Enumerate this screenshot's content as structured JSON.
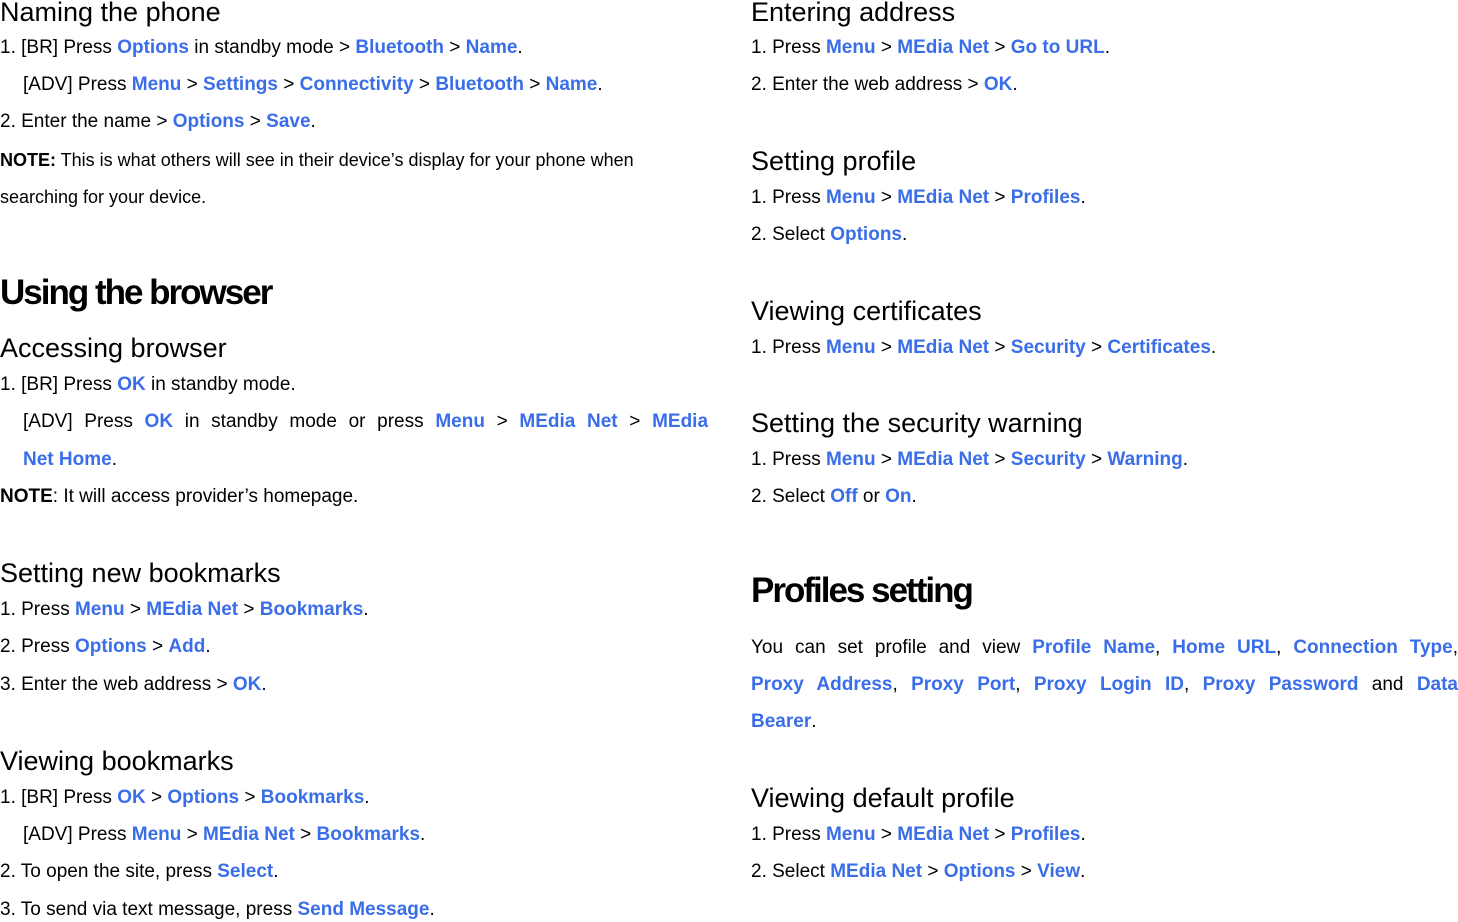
{
  "left": {
    "naming": {
      "title": "Naming the phone",
      "l1": {
        "a": "1. [BR] Press ",
        "k1": "Options",
        "b": " in standby mode > ",
        "k2": "Bluetooth",
        "c": " > ",
        "k3": "Name",
        "d": "."
      },
      "l2": {
        "a": "[ADV] Press ",
        "k1": "Menu",
        "b": " > ",
        "k2": "Settings",
        "c": " > ",
        "k3": "Connectivity",
        "d": " > ",
        "k4": "Bluetooth",
        "e": " > ",
        "k5": "Name",
        "f": "."
      },
      "l3": {
        "a": "2. Enter the name > ",
        "k1": "Options",
        "b": " > ",
        "k2": "Save",
        "c": "."
      },
      "note": {
        "label": "NOTE:",
        "text1": " This is what others will see in their device’s display for your phone when",
        "text2": "searching for your device."
      }
    },
    "browser": {
      "heading": "Using the browser",
      "accessing": {
        "title": "Accessing browser",
        "l1": {
          "a": "1. [BR] Press ",
          "k1": "OK",
          "b": " in standby mode."
        },
        "l2": {
          "a": "[ADV] Press ",
          "k1": "OK",
          "b": " in standby mode or press ",
          "k2": "Menu",
          "c": " > ",
          "k3": "MEdia Net",
          "d": " > ",
          "k4": "MEdia"
        },
        "l3": {
          "k1": "Net Home",
          "a": "."
        },
        "note": {
          "label": "NOTE",
          "text": ": It will access provider’s homepage."
        }
      },
      "new_bookmarks": {
        "title": "Setting new bookmarks",
        "l1": {
          "a": "1. Press ",
          "k1": "Menu",
          "b": " > ",
          "k2": "MEdia Net",
          "c": " > ",
          "k3": "Bookmarks",
          "d": "."
        },
        "l2": {
          "a": "2. Press ",
          "k1": "Options",
          "b": " > ",
          "k2": "Add",
          "c": "."
        },
        "l3": {
          "a": "3. Enter the web address > ",
          "k1": "OK",
          "b": "."
        }
      },
      "viewing_bookmarks": {
        "title": "Viewing bookmarks",
        "l1": {
          "a": "1. [BR] Press ",
          "k1": "OK",
          "b": " > ",
          "k2": "Options",
          "c": " > ",
          "k3": "Bookmarks",
          "d": "."
        },
        "l2": {
          "a": "[ADV] Press ",
          "k1": "Menu",
          "b": " > ",
          "k2": "MEdia Net",
          "c": " > ",
          "k3": "Bookmarks",
          "d": "."
        },
        "l3": {
          "a": "2. To open the site, press ",
          "k1": "Select",
          "b": "."
        },
        "l4": {
          "a": "3. To send via text message, press ",
          "k1": "Send Message",
          "b": "."
        }
      }
    }
  },
  "right": {
    "entering_address": {
      "title": "Entering address",
      "l1": {
        "a": "1. Press ",
        "k1": "Menu",
        "b": " > ",
        "k2": "MEdia Net",
        "c": " > ",
        "k3": "Go to URL",
        "d": "."
      },
      "l2": {
        "a": "2. Enter the web address > ",
        "k1": "OK",
        "b": "."
      }
    },
    "setting_profile": {
      "title": "Setting profile",
      "l1": {
        "a": "1. Press ",
        "k1": "Menu",
        "b": " > ",
        "k2": "MEdia Net",
        "c": " > ",
        "k3": "Profiles",
        "d": "."
      },
      "l2": {
        "a": "2. Select ",
        "k1": "Options",
        "b": "."
      }
    },
    "certificates": {
      "title": "Viewing certificates",
      "l1": {
        "a": "1. Press ",
        "k1": "Menu",
        "b": " > ",
        "k2": "MEdia Net",
        "c": " > ",
        "k3": "Security",
        "d": " > ",
        "k4": "Certificates",
        "e": "."
      }
    },
    "security_warning": {
      "title": "Setting the security warning",
      "l1": {
        "a": "1. Press ",
        "k1": "Menu",
        "b": " > ",
        "k2": "MEdia Net",
        "c": " > ",
        "k3": "Security",
        "d": " > ",
        "k4": "Warning",
        "e": "."
      },
      "l2": {
        "a": "2. Select ",
        "k1": "Off",
        "b": " or ",
        "k2": "On",
        "c": "."
      }
    },
    "profiles_setting": {
      "heading": "Profiles setting",
      "l1": {
        "a": "You can set profile and view ",
        "k1": "Profile Name",
        "b": ", ",
        "k2": "Home URL",
        "c": ", ",
        "k3": "Connection Type",
        "d": ","
      },
      "l2": {
        "k1": "Proxy Address",
        "a": ", ",
        "k2": "Proxy Port",
        "b": ", ",
        "k3": "Proxy Login ID",
        "c": ", ",
        "k4": "Proxy Password",
        "d": " and ",
        "k5": "Data"
      },
      "l3": {
        "k1": "Bearer",
        "a": "."
      }
    },
    "default_profile": {
      "title": "Viewing default profile",
      "l1": {
        "a": "1. Press ",
        "k1": "Menu",
        "b": " > ",
        "k2": "MEdia Net",
        "c": " > ",
        "k3": "Profiles",
        "d": "."
      },
      "l2": {
        "a": "2. Select ",
        "k1": "MEdia Net",
        "b": " > ",
        "k2": "Options",
        "c": " > ",
        "k3": "View",
        "d": "."
      }
    }
  }
}
